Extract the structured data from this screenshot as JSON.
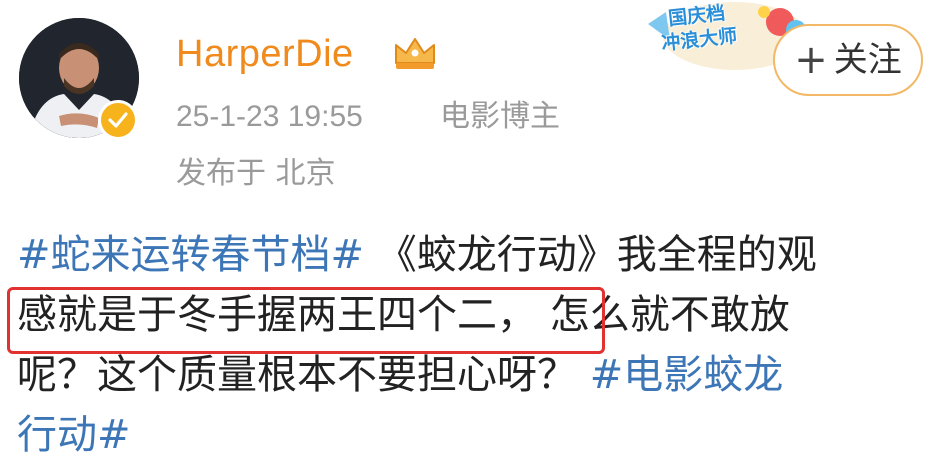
{
  "author": {
    "username": "HarperDie",
    "avatar_icon": "avatar-photo-icon",
    "verified_icon": "verified-badge-icon",
    "crown_icon": "crown-icon"
  },
  "meta": {
    "time": "25-1-23 19:55",
    "role": "电影博主",
    "location": "发布于 北京"
  },
  "event_badge": {
    "line1": "国庆档",
    "line2": "冲浪大师"
  },
  "follow_button": {
    "plus": "+",
    "label": "关注"
  },
  "post": {
    "line1_hashtag": "#蛇来运转春节档#",
    "line1_text": "《蛟龙行动》我全程的观",
    "line2_text": "感就是于冬手握两王四个二，",
    "line2_text_b": "怎么就不敢放",
    "line3_text": "呢？这个质量根本不要担心呀？",
    "line3_hashtag": "#电影蛟龙",
    "line4_hashtag": "行动#"
  },
  "colors": {
    "username": "#f08a1c",
    "meta": "#9a9a9a",
    "hashtag": "#3d76b6",
    "highlight": "#e23131",
    "follow_border": "#f2b866"
  }
}
